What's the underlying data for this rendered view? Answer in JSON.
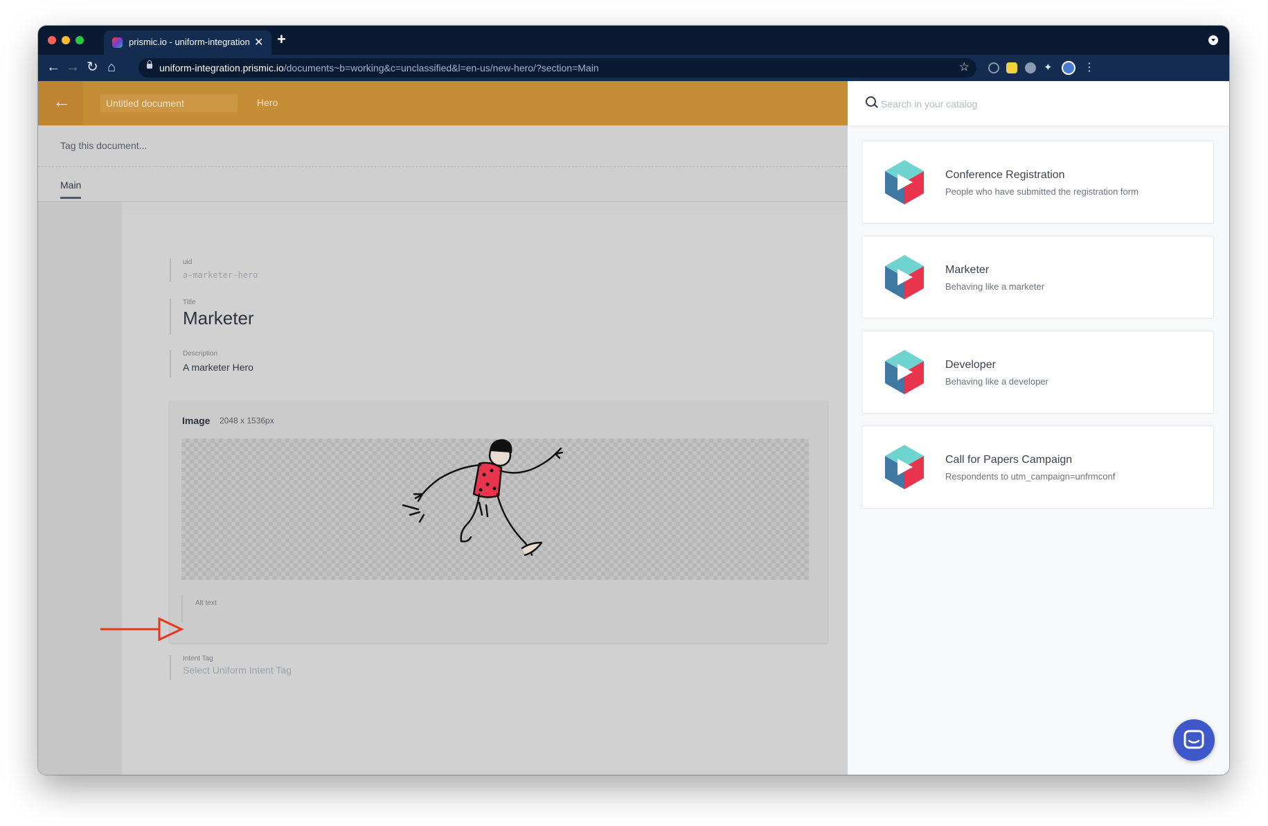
{
  "browser": {
    "tab_title": "prismic.io - uniform-integration",
    "tab_close": "✕",
    "new_tab": "+",
    "url_host": "uniform-integration.prismic.io",
    "url_path": "/documents~b=working&c=unclassified&l=en-us/new-hero/?section=Main",
    "back": "←",
    "forward": "→",
    "reload": "↻",
    "home": "⌂",
    "star": "☆"
  },
  "editor": {
    "back_arrow": "←",
    "document_title": "Untitled document",
    "custom_type": "Hero",
    "tag_placeholder": "Tag this document...",
    "tabs": [
      {
        "label": "Main",
        "active": true
      }
    ],
    "fields": {
      "uid": {
        "label": "uid",
        "value": "a-marketer-hero"
      },
      "title": {
        "label": "Title",
        "value": "Marketer"
      },
      "description": {
        "label": "Description",
        "value": "A marketer Hero"
      },
      "image": {
        "label": "Image",
        "dimensions": "2048 x 1536px",
        "alt_label": "Alt text"
      },
      "intent_tag": {
        "label": "Intent Tag",
        "placeholder": "Select Uniform Intent Tag"
      }
    }
  },
  "catalog": {
    "search_placeholder": "Search in your catalog",
    "items": [
      {
        "title": "Conference Registration",
        "subtitle": "People who have submitted the registration form"
      },
      {
        "title": "Marketer",
        "subtitle": "Behaving like a marketer"
      },
      {
        "title": "Developer",
        "subtitle": "Behaving like a developer"
      },
      {
        "title": "Call for Papers Campaign",
        "subtitle": "Respondents to utm_campaign=unfrmconf"
      }
    ]
  },
  "colors": {
    "header": "#c68d37",
    "browser_dark": "#0b1a33",
    "annotation_arrow": "#e8361d",
    "logo_teal": "#6fd3d0",
    "logo_blue": "#3e78a3",
    "logo_red": "#e8344c",
    "chat": "#3f58c9"
  },
  "icons": [
    "search-icon",
    "back-arrow-icon",
    "star-icon",
    "chat-icon",
    "lock-icon"
  ]
}
